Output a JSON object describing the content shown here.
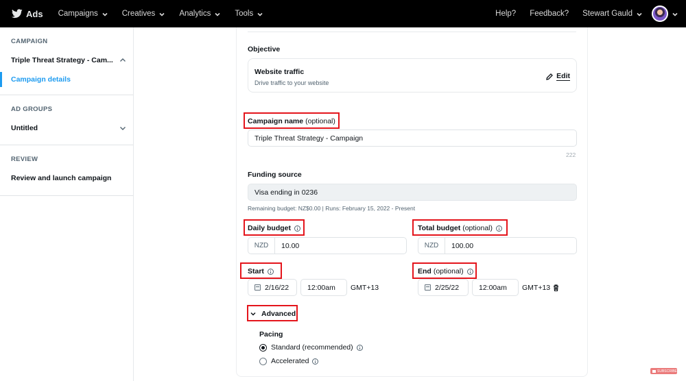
{
  "topnav": {
    "brand": "Ads",
    "menus": [
      {
        "label": "Campaigns"
      },
      {
        "label": "Creatives"
      },
      {
        "label": "Analytics"
      },
      {
        "label": "Tools"
      }
    ],
    "help": "Help?",
    "feedback": "Feedback?",
    "user_name": "Stewart Gauld"
  },
  "sidebar": {
    "campaign_heading": "CAMPAIGN",
    "campaign_name": "Triple Threat Strategy - Cam...",
    "campaign_details": "Campaign details",
    "ad_groups_heading": "AD GROUPS",
    "ad_group_name": "Untitled",
    "review_heading": "REVIEW",
    "review_item": "Review and launch campaign"
  },
  "form": {
    "objective": {
      "label": "Objective",
      "title": "Website traffic",
      "description": "Drive traffic to your website",
      "edit_label": "Edit"
    },
    "campaign_name": {
      "label": "Campaign name",
      "optional": "(optional)",
      "value": "Triple Threat Strategy - Campaign",
      "remaining_chars": "222"
    },
    "funding_source": {
      "label": "Funding source",
      "value": "Visa ending in 0236",
      "helper": "Remaining budget: NZ$0.00 | Runs: February 15, 2022 - Present"
    },
    "daily_budget": {
      "label": "Daily budget",
      "currency": "NZD",
      "value": "10.00"
    },
    "total_budget": {
      "label": "Total budget",
      "optional": "(optional)",
      "currency": "NZD",
      "value": "100.00"
    },
    "start": {
      "label": "Start",
      "date": "2/16/22",
      "time": "12:00am",
      "timezone": "GMT+13"
    },
    "end": {
      "label": "End",
      "optional": "(optional)",
      "date": "2/25/22",
      "time": "12:00am",
      "timezone": "GMT+13"
    },
    "advanced": {
      "label": "Advanced",
      "pacing_label": "Pacing",
      "options": [
        {
          "label": "Standard (recommended)",
          "selected": true
        },
        {
          "label": "Accelerated",
          "selected": false
        }
      ]
    }
  },
  "overlay": {
    "subscribe_badge": "SUBSCRIBE",
    "highlight_color": "#e4141b"
  },
  "colors": {
    "accent": "#1d9bf0",
    "nav_bg": "#000000"
  }
}
